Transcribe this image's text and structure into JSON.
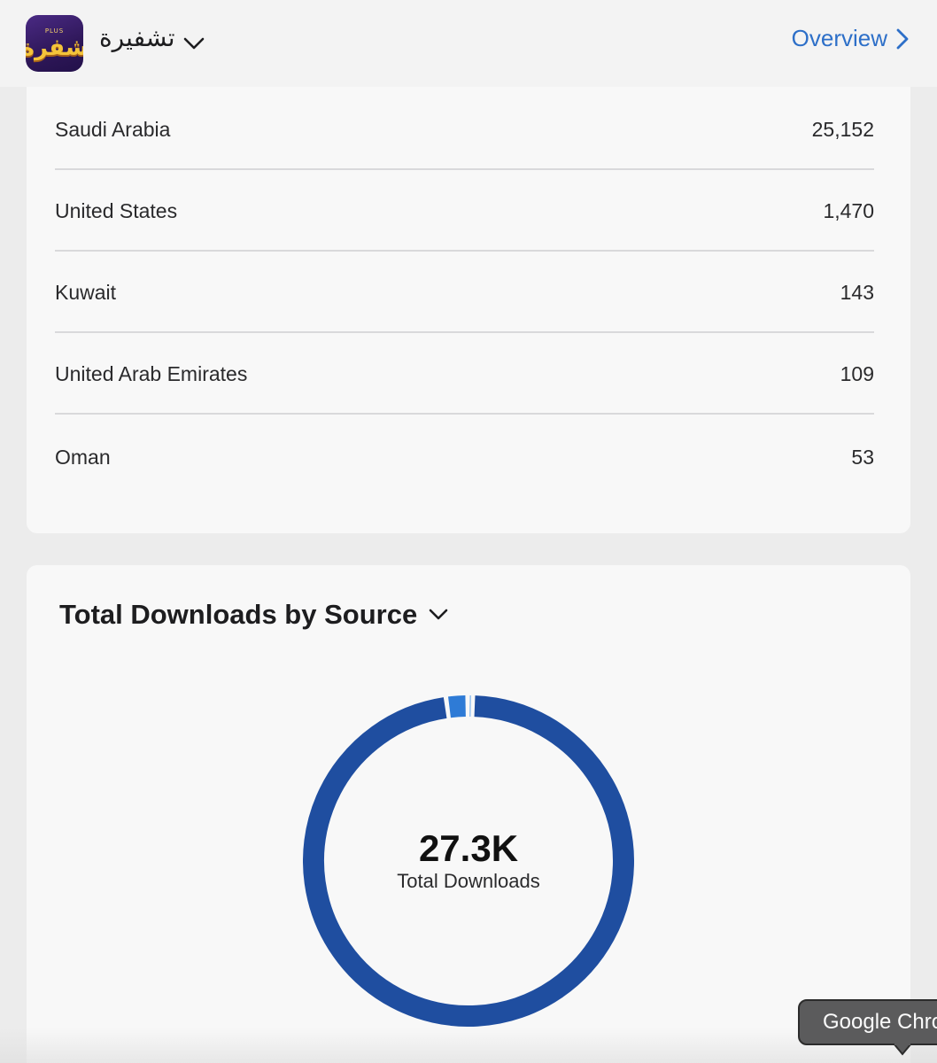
{
  "header": {
    "app_name": "تشفيرة",
    "app_icon_text": "شفرة",
    "app_icon_sub": "PLUS",
    "overview_label": "Overview"
  },
  "countries": [
    {
      "name": "Saudi Arabia",
      "value": "25,152"
    },
    {
      "name": "United States",
      "value": "1,470"
    },
    {
      "name": "Kuwait",
      "value": "143"
    },
    {
      "name": "United Arab Emirates",
      "value": "109"
    },
    {
      "name": "Oman",
      "value": "53"
    }
  ],
  "downloads": {
    "title": "Total Downloads by Source",
    "total_value": "27.3K",
    "total_label": "Total Downloads"
  },
  "chart_data": {
    "type": "pie",
    "donut": true,
    "title": "Total Downloads by Source",
    "center_value": "27.3K",
    "center_label": "Total Downloads",
    "slices": [
      {
        "share": 0.974,
        "color": "#1f4ea0"
      },
      {
        "share": 0.021,
        "color": "#2e7bd6"
      },
      {
        "share": 0.005,
        "color": "#5aa0ea"
      }
    ]
  },
  "tooltip": {
    "text": "Google Chrome"
  },
  "colors": {
    "accent": "#2d6fc8",
    "donut_primary": "#1f4ea0",
    "card_bg": "#f8f8f8"
  }
}
